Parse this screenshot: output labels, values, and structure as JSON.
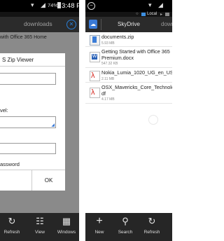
{
  "left_screen": {
    "status": {
      "battery": "74%",
      "time": "3:48 PM"
    },
    "toolbar": {
      "title": "downloads"
    },
    "background_text": "with Office 365 Home",
    "dialog": {
      "title": "S Zip Viewer",
      "label_level": "vel:",
      "label_password": "assword",
      "cancel_label": "",
      "ok_label": "OK"
    },
    "bottom_nav": {
      "refresh": "Refresh",
      "view": "View",
      "windows": "Windows"
    }
  },
  "right_screen": {
    "titlebar": {
      "local": "Local"
    },
    "toolbar": {
      "tab_skydrive": "SkyDrive",
      "tab_downloads": "downl"
    },
    "files": [
      {
        "name": "documents.zip",
        "size": "5.93 MB",
        "icon": "zip-icon"
      },
      {
        "name_line1": "Getting Started with Office 365",
        "name_line2": "Premium.docx",
        "size": "547.32 KB",
        "icon": "docx-icon"
      },
      {
        "name": "Nokia_Lumia_1020_UG_en_US",
        "size": "2.11 MB",
        "icon": "pdf-icon"
      },
      {
        "name_line1": "OSX_Mavericks_Core_Technolo",
        "name_line2": "df",
        "size": "4.17 MB",
        "icon": "pdf-icon"
      }
    ],
    "bottom_nav": {
      "new": "New",
      "search": "Search",
      "refresh": "Refresh"
    }
  }
}
